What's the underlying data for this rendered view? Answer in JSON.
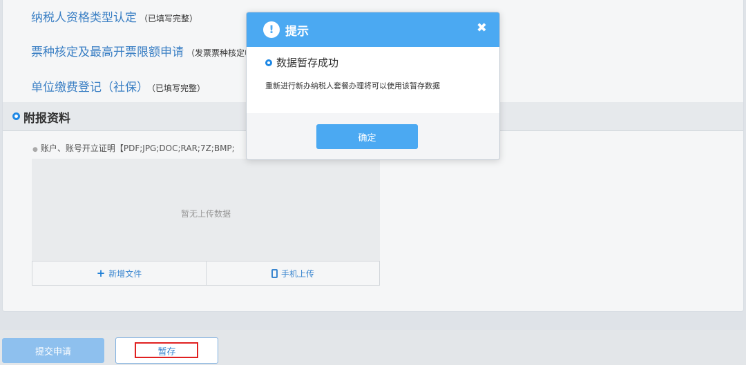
{
  "form_links": [
    {
      "label": "纳税人资格类型认定",
      "status": "（已填写完整）"
    },
    {
      "label": "票种核定及最高开票限额申请",
      "status": "（发票票种核定申"
    },
    {
      "label": "单位缴费登记（社保）",
      "status": "（已填写完整）"
    }
  ],
  "attachments": {
    "section_title": "附报资料",
    "doc_label": "账户、账号开立证明【PDF;JPG;DOC;RAR;7Z;BMP;",
    "empty_text": "暂无上传数据",
    "add_file_label": "新增文件",
    "mobile_upload_label": "手机上传"
  },
  "bottom": {
    "submit_label": "提交申请",
    "save_label": "暂存"
  },
  "modal": {
    "title": "提示",
    "alert_glyph": "!",
    "close_glyph": "✖",
    "message_title": "数据暂存成功",
    "message_desc": "重新进行新办纳税人套餐办理将可以使用该暂存数据",
    "ok_label": "确定"
  },
  "colors": {
    "accent": "#4ba9f2",
    "link": "#3a7fc4",
    "highlight": "#e02020"
  },
  "icons": {
    "plus": "+",
    "alert": "alert-icon",
    "close": "close-icon",
    "phone": "phone-icon"
  }
}
